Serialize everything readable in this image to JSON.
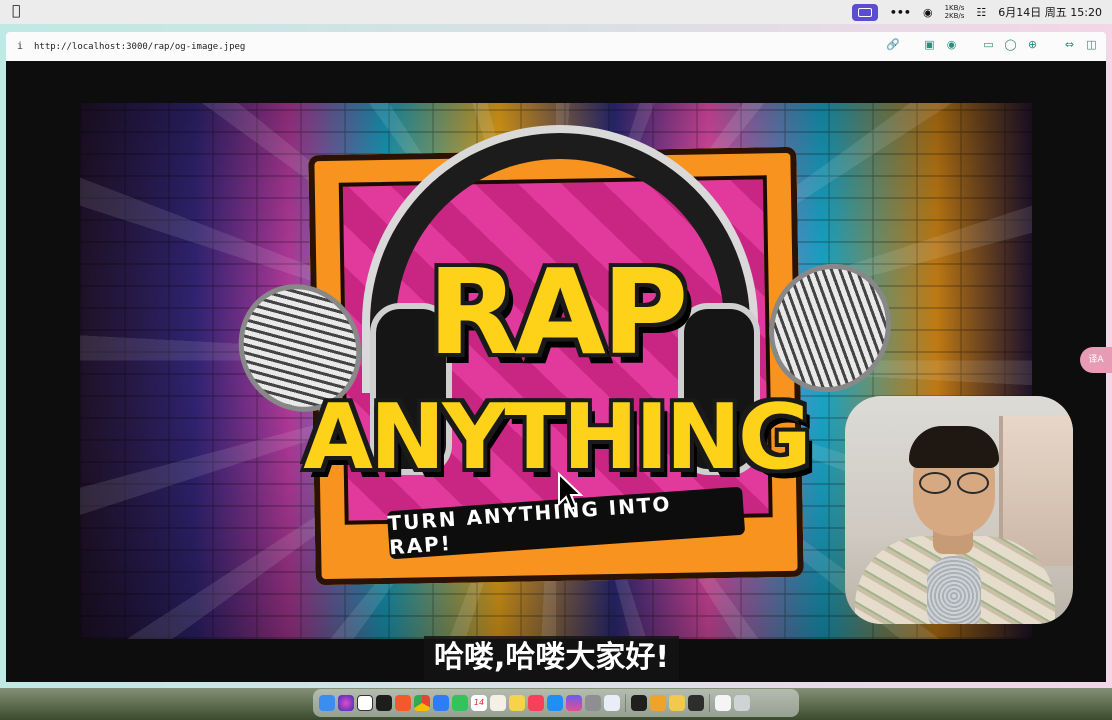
{
  "menubar": {
    "net_up": "1KB/s",
    "net_down": "2KB/s",
    "clock": "6月14日 周五 15:20"
  },
  "browser": {
    "info_label": "i",
    "url": "http://localhost:3000/rap/og-image.jpeg",
    "tool_icons": [
      "link-icon",
      "screenshot-icon",
      "camera-icon",
      "terminal-icon",
      "globe-icon",
      "crosshair-icon",
      "expand-icon",
      "sidebar-icon"
    ]
  },
  "poster": {
    "title_line1": "RAP",
    "title_line2": "ANYTHING",
    "tagline": "TURN ANYTHING INTO RAP!"
  },
  "subtitle": "哈喽,哈喽大家好!",
  "translate_bubble": "译A",
  "dock": {
    "apps": [
      "finder",
      "siri",
      "chatgpt",
      "terminal",
      "swift",
      "chrome",
      "safari",
      "messages",
      "calendar",
      "notes",
      "music",
      "appstore",
      "launchpad",
      "settings",
      "preview",
      "capcut",
      "photos",
      "notes2",
      "trash"
    ],
    "calendar_day": "14"
  },
  "colors": {
    "accent": "#5b4dd1",
    "toolbar_icon": "#2a8f7f",
    "title_yellow": "#ffd21a",
    "sign_orange": "#f7931e"
  }
}
